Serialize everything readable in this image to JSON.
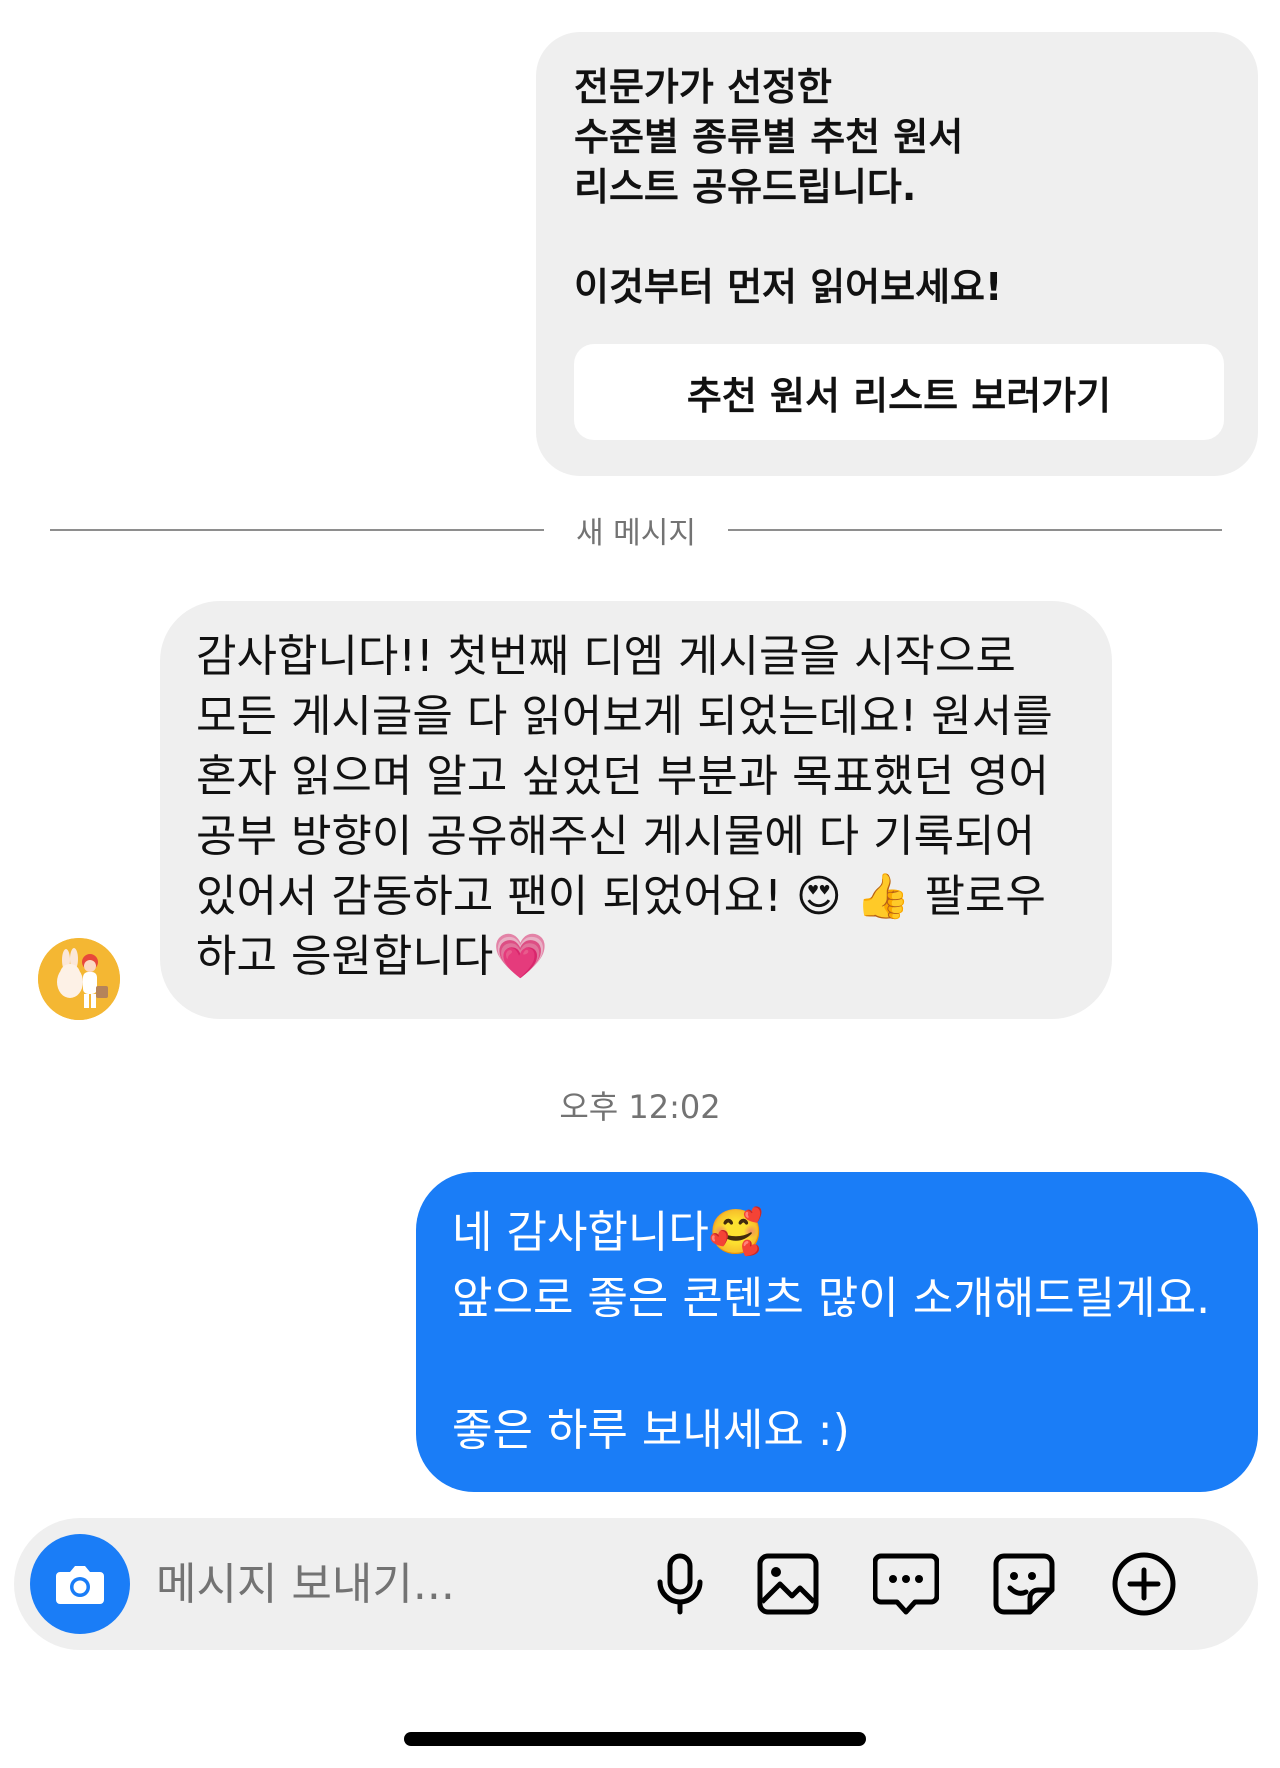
{
  "card": {
    "lines": [
      "전문가가 선정한",
      "수준별 종류별 추천 원서",
      "리스트 공유드립니다."
    ],
    "line_after_gap": "이것부터 먼저 읽어보세요!",
    "button_label": "추천 원서 리스트 보러가기"
  },
  "divider": {
    "label": "새 메시지"
  },
  "incoming": {
    "lines": [
      "감사합니다!! 첫번째 디엠 게시글을 시작으로",
      "모든 게시글을 다 읽어보게 되었는데요! 원서를",
      "혼자 읽으며 알고 싶었던 부분과 목표했던 영어",
      "공부 방향이 공유해주신 게시물에 다 기록되어",
      "있어서 감동하고 팬이 되었어요! 😍 👍 팔로우",
      "하고 응원합니다💗"
    ]
  },
  "timestamp": "오후 12:02",
  "outgoing": {
    "line1": "네 감사합니다🥰",
    "line2": "앞으로 좋은 콘텐츠 많이 소개해드릴게요.",
    "line3": "좋은 하루 보내세요 :)"
  },
  "composer": {
    "placeholder": "메시지 보내기..."
  },
  "icons": {
    "camera": "camera-icon",
    "microphone": "microphone-icon",
    "gallery": "image-icon",
    "chat": "message-icon",
    "sticker": "sticker-icon",
    "add": "plus-circle-icon"
  },
  "colors": {
    "accent": "#1a7df7",
    "bubble_grey": "#efefef",
    "muted_text": "#737373"
  }
}
